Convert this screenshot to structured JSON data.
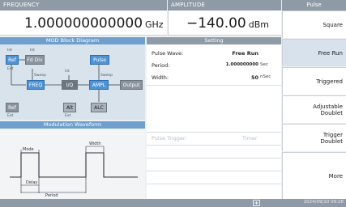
{
  "colors": {
    "header_bg": "#8e9aa6",
    "panel_title_blue": "#6f9fcd",
    "block_blue": "#4f93d5",
    "block_gray": "#8a939c"
  },
  "frequency": {
    "label": "FREQUENCY",
    "value": "1.000000000000",
    "unit": "GHz"
  },
  "amplitude": {
    "label": "AMPLITUDE",
    "value": "−140.00",
    "unit": "dBm"
  },
  "diagram": {
    "title": "MOD Block Diagram",
    "blocks": {
      "ref": "Ref",
      "fdiv": "Fd Div",
      "freq": "FREQ",
      "iq": "I/Q",
      "pulse": "Pulse",
      "ampl": "AMPL",
      "output": "Output",
      "ref2": "Ref",
      "alt": "Alt",
      "alc": "ALC"
    },
    "labels": {
      "int1": "Int",
      "int2": "Int",
      "int3": "Int",
      "sweep1": "Sweep",
      "sweep2": "Sweep",
      "ext1": "Ext",
      "ext2": "Ext",
      "ext3": "Ext"
    }
  },
  "waveform": {
    "title": "Modulation Waveform",
    "labels": {
      "mode": "Mode",
      "width": "Width",
      "delay": "Delay",
      "period": "Period"
    }
  },
  "setting": {
    "title": "Setting",
    "rows": [
      {
        "key": "Pulse Wave:",
        "value": "Free Run",
        "unit": ""
      },
      {
        "key": "Period:",
        "value": "1.000000000",
        "unit": "Sec"
      },
      {
        "key": "Width:",
        "value": "50",
        "unit": "nSec"
      }
    ],
    "trigger": {
      "key": "Pulse Trigger:",
      "value": "Timer"
    }
  },
  "softkeys": {
    "title": "Pulse",
    "items": [
      {
        "label": "Square"
      },
      {
        "label": "Free Run"
      },
      {
        "label": "Triggered"
      },
      {
        "label": "Adjustable Doublet"
      },
      {
        "label": "Trigger Doublet"
      },
      {
        "label": "More"
      }
    ]
  },
  "status": {
    "datetime": "2024/09/10 09:28"
  }
}
